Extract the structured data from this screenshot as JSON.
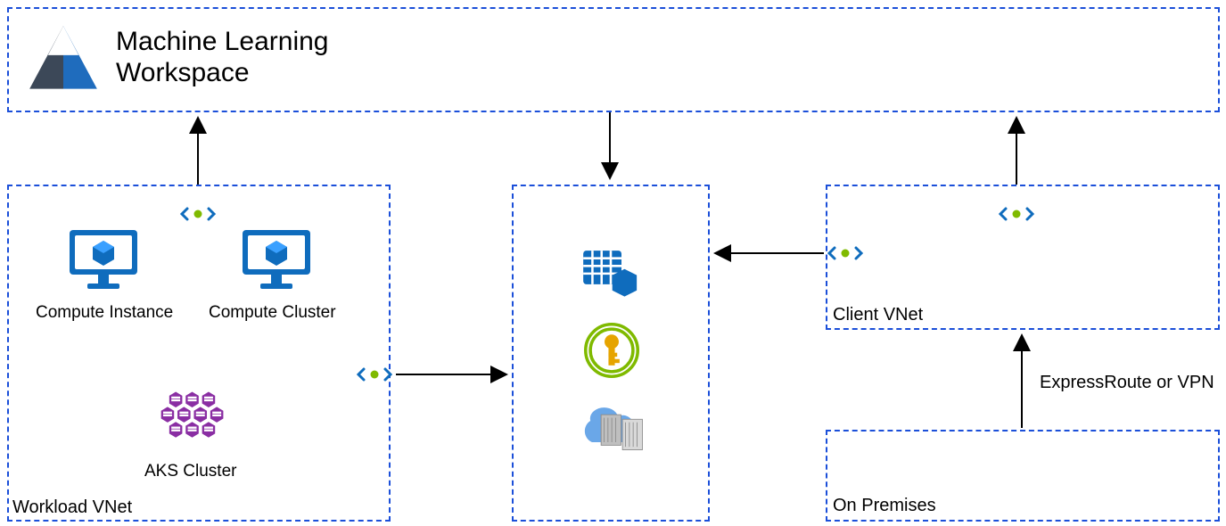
{
  "workspace": {
    "title_line1": "Machine Learning",
    "title_line2": "Workspace"
  },
  "workload_vnet": {
    "label": "Workload VNet",
    "compute_instance": "Compute Instance",
    "compute_cluster": "Compute Cluster",
    "aks_cluster": "AKS Cluster"
  },
  "client_vnet": {
    "label": "Client VNet"
  },
  "on_premises": {
    "label": "On Premises"
  },
  "connection": {
    "expressroute": "ExpressRoute or VPN"
  },
  "colors": {
    "azure_blue": "#0f6cbd",
    "dashed_blue": "#1b4fd9",
    "ml_logo_dark": "#3c4858",
    "ml_logo_blue": "#1f6cbd",
    "aks_purple": "#8a2ea3",
    "keyvault_green": "#7fba00",
    "keyvault_gold": "#e6a400",
    "storage_grey": "#8a8a8a",
    "endpoint_green": "#7fba00",
    "black": "#000000"
  },
  "nodes": {
    "ml_workspace": "Azure Machine Learning Workspace",
    "workload_vnet": "Workload virtual network",
    "client_vnet": "Client virtual network",
    "on_premises": "On-premises network",
    "resources_box": "Private resources (Storage, Key Vault, Container Registry)",
    "compute_instance": "Compute Instance VM",
    "compute_cluster": "Compute Cluster VMs",
    "aks": "AKS Cluster",
    "private_endpoint": "Private endpoint"
  },
  "edges": [
    {
      "from": "workload_vnet",
      "to": "ml_workspace",
      "kind": "private-endpoint"
    },
    {
      "from": "client_vnet",
      "to": "ml_workspace",
      "kind": "private-endpoint"
    },
    {
      "from": "ml_workspace",
      "to": "resources_box",
      "kind": "downlink"
    },
    {
      "from": "workload_vnet",
      "to": "resources_box",
      "kind": "private-endpoint"
    },
    {
      "from": "client_vnet",
      "to": "resources_box",
      "kind": "private-endpoint"
    },
    {
      "from": "on_premises",
      "to": "client_vnet",
      "kind": "expressroute-or-vpn"
    }
  ]
}
